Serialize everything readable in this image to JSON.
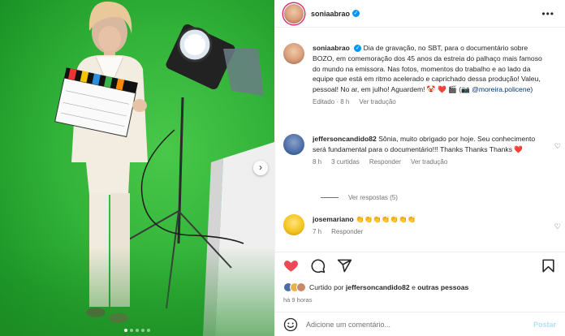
{
  "post": {
    "author": "soniaabrao",
    "author_avatar_color": "#d89d7a",
    "image_alt_icon": "photo-carousel",
    "carousel": {
      "total_slides": 5,
      "active_slide": 1
    },
    "next_icon": "›",
    "more_icon": "•••"
  },
  "caption": {
    "username": "soniaabrao",
    "text": "Dia de gravação, no SBT, para o documentário sobre BOZO, em comemoração dos 45 anos da estreia do palhaço mais famoso do mundo na emissora. Nas fotos, momentos do trabalho e ao lado da equipe que está em ritmo acelerado e caprichado dessa produção! Valeu, pessoal! No ar, em julho! Aguardem! 🤡 ❤️ 🎬",
    "credit_prefix": "(📷",
    "credit_link": "@moreira.policene",
    "credit_suffix": ")",
    "meta_time": "Editado · 8 h",
    "translate": "Ver tradução"
  },
  "comments": [
    {
      "username": "jeffersoncandido82",
      "avatar_color": "#4a6da7",
      "text": "Sônia, muito obrigado por hoje. Seu conhecimento será fundamental para o documentário!!! Thanks Thanks Thanks ❤️",
      "time": "8 h",
      "likes": "3 curtidas",
      "reply": "Responder",
      "translate": "Ver tradução",
      "replies": "Ver respostas (5)"
    },
    {
      "username": "josemariano",
      "avatar_color": "#f3c21a",
      "text": "👏👏👏👏👏👏👏",
      "time": "7 h",
      "reply": "Responder"
    }
  ],
  "actions": {
    "like_color": "#ed4956",
    "liked_by_prefix": "Curtido por",
    "liked_by_user": "jeffersoncandido82",
    "liked_by_suffix": "e",
    "liked_by_others": "outras pessoas",
    "time_ago": "há 9 horas",
    "comment_placeholder": "Adicione um comentário...",
    "post_button": "Postar"
  }
}
